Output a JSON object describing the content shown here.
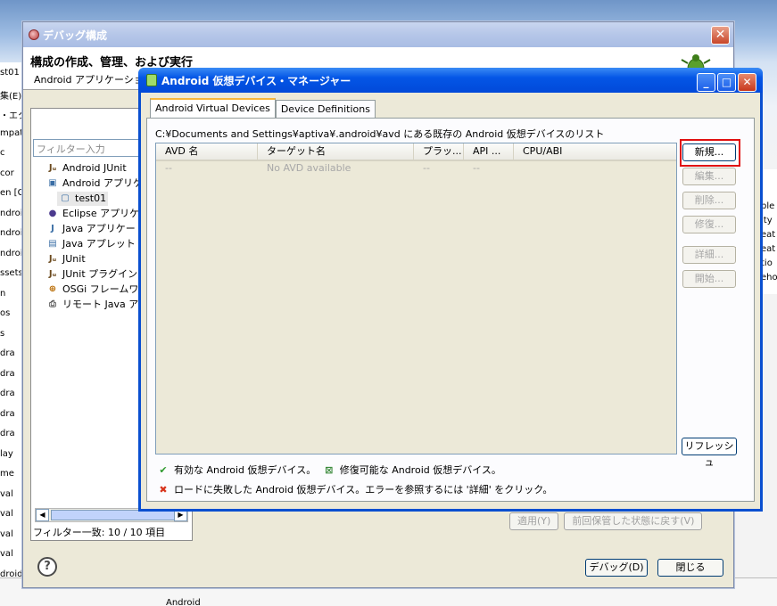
{
  "background": {
    "left_fragments": [
      "st01",
      "集(E)",
      "・エク",
      "mpat",
      "c",
      "cor",
      "en [G",
      "ndroi",
      "ndroi",
      "ndroi",
      "ssets",
      "n",
      "os",
      "s",
      "dra",
      "dra",
      "dra",
      "dra",
      "dra",
      "lay",
      "me",
      "val",
      "val",
      "val",
      "val"
    ],
    "right_fragments": [
      "ple",
      "ity",
      "eat",
      "eat",
      "tio",
      "eho"
    ],
    "bottom_file": "droidManifest.xml",
    "bottom_sub": "Android"
  },
  "debug_dialog": {
    "title": "デバッグ構成",
    "heading": "構成の作成、管理、および実行",
    "subheading": "Android アプリケーション",
    "filter_placeholder": "フィルター入力",
    "tree": [
      {
        "label": "Android JUnit",
        "icon": "junit-icon"
      },
      {
        "label": "Android アプリケ",
        "icon": "android-app-icon"
      },
      {
        "label": "test01",
        "icon": "config-icon"
      },
      {
        "label": "Eclipse アプリケ",
        "icon": "eclipse-icon"
      },
      {
        "label": "Java アプリケー",
        "icon": "java-app-icon"
      },
      {
        "label": "Java アプレット",
        "icon": "applet-icon"
      },
      {
        "label": "JUnit",
        "icon": "junit-icon"
      },
      {
        "label": "JUnit プラグイン",
        "icon": "junit-plugin-icon"
      },
      {
        "label": "OSGi フレームワ",
        "icon": "osgi-icon"
      },
      {
        "label": "リモート Java ア",
        "icon": "remote-java-icon"
      }
    ],
    "filter_count": "フィルター一致: 10 / 10 項目",
    "apply_label": "適用(Y)",
    "revert_label": "前回保管した状態に戻す(V)",
    "debug_label": "デバッグ(D)",
    "close_label": "閉じる"
  },
  "avd_manager": {
    "title": "Android 仮想デバイス・マネージャー",
    "tabs": [
      "Android Virtual Devices",
      "Device Definitions"
    ],
    "path_text": "C:¥Documents and Settings¥aptiva¥.android¥avd にある既存の Android 仮想デバイスのリスト",
    "columns": [
      "AVD 名",
      "ターゲット名",
      "プラッ...",
      "API ...",
      "CPU/ABI"
    ],
    "rows": [
      [
        "--",
        "No AVD available",
        "--",
        "--",
        ""
      ]
    ],
    "buttons": {
      "new": "新規...",
      "edit": "編集...",
      "delete": "削除...",
      "repair": "修復...",
      "details": "詳細...",
      "start": "開始...",
      "refresh": "リフレッシュ"
    },
    "legend": {
      "valid": "有効な Android 仮想デバイス。",
      "repairable": "修復可能な Android 仮想デバイス。",
      "failed": "ロードに失敗した Android 仮想デバイス。エラーを参照するには '詳細' をクリック。"
    }
  },
  "colors": {
    "highlight": "#e01010",
    "xp_title": "#0149d9",
    "valid_check": "#2e9a2e",
    "fail_x": "#d8341c"
  }
}
